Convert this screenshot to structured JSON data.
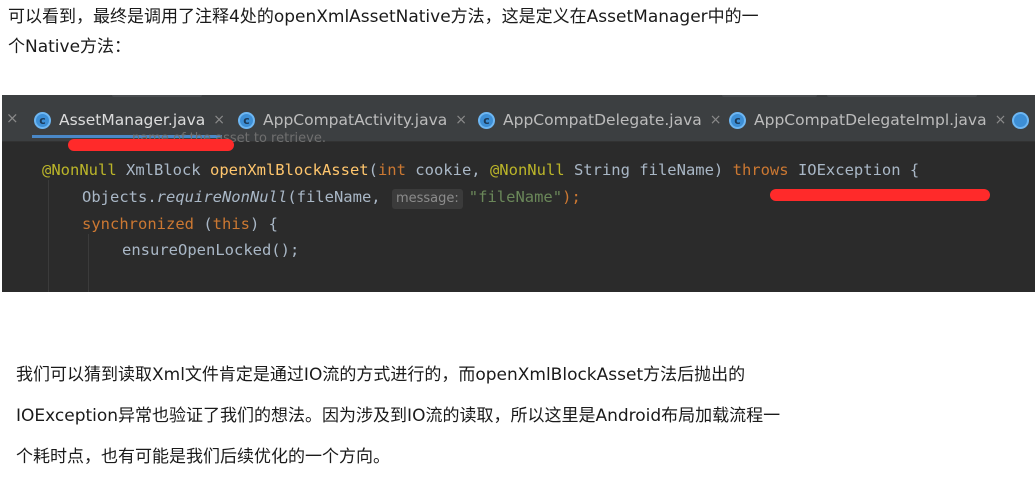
{
  "intro": {
    "line1": "可以看到，最终是调用了注释4处的openXmlAssetNative方法，这是定义在AssetManager中的一",
    "line2": "个Native方法："
  },
  "ide": {
    "tabs": [
      {
        "label": "AssetManager.java",
        "close": "×",
        "icon_letter": "c",
        "active": true
      },
      {
        "label": "AppCompatActivity.java",
        "close": "×",
        "icon_letter": "c",
        "active": false
      },
      {
        "label": "AppCompatDelegate.java",
        "close": "×",
        "icon_letter": "c",
        "active": false
      },
      {
        "label": "AppCompatDelegateImpl.java",
        "close": "×",
        "icon_letter": "c",
        "active": false
      }
    ],
    "left_close": "×",
    "doc_fragment": "name of the asset to retrieve.",
    "code": {
      "l1": {
        "a1": "@NonNull",
        "t1": " XmlBlock ",
        "m": "openXmlBlockAsset",
        "t2": "(",
        "k1": "int",
        "t3": " cookie, ",
        "a2": "@NonNull",
        "t4": " String fileName) ",
        "k2": "throws",
        "t5": " IOException {"
      },
      "l2": {
        "t1": "Objects.",
        "m": "requireNonNull",
        "t2": "(fileName, ",
        "hint": "message:",
        "s": "\"fileName\"",
        "t3": ");"
      },
      "l3": {
        "k1": "synchronized",
        "t1": " (",
        "k2": "this",
        "t2": ") {"
      },
      "l4": {
        "t1": "ensureOpenLocked();"
      }
    },
    "highlight_color": "#ff2a2a",
    "accent_color": "#4a88c7"
  },
  "outro": {
    "line1": "我们可以猜到读取Xml文件肯定是通过IO流的方式进行的，而openXmlBlockAsset方法后抛出的",
    "line2": "IOException异常也验证了我们的想法。因为涉及到IO流的读取，所以这里是Android布局加载流程一",
    "line3": "个耗时点，也有可能是我们后续优化的一个方向。"
  }
}
